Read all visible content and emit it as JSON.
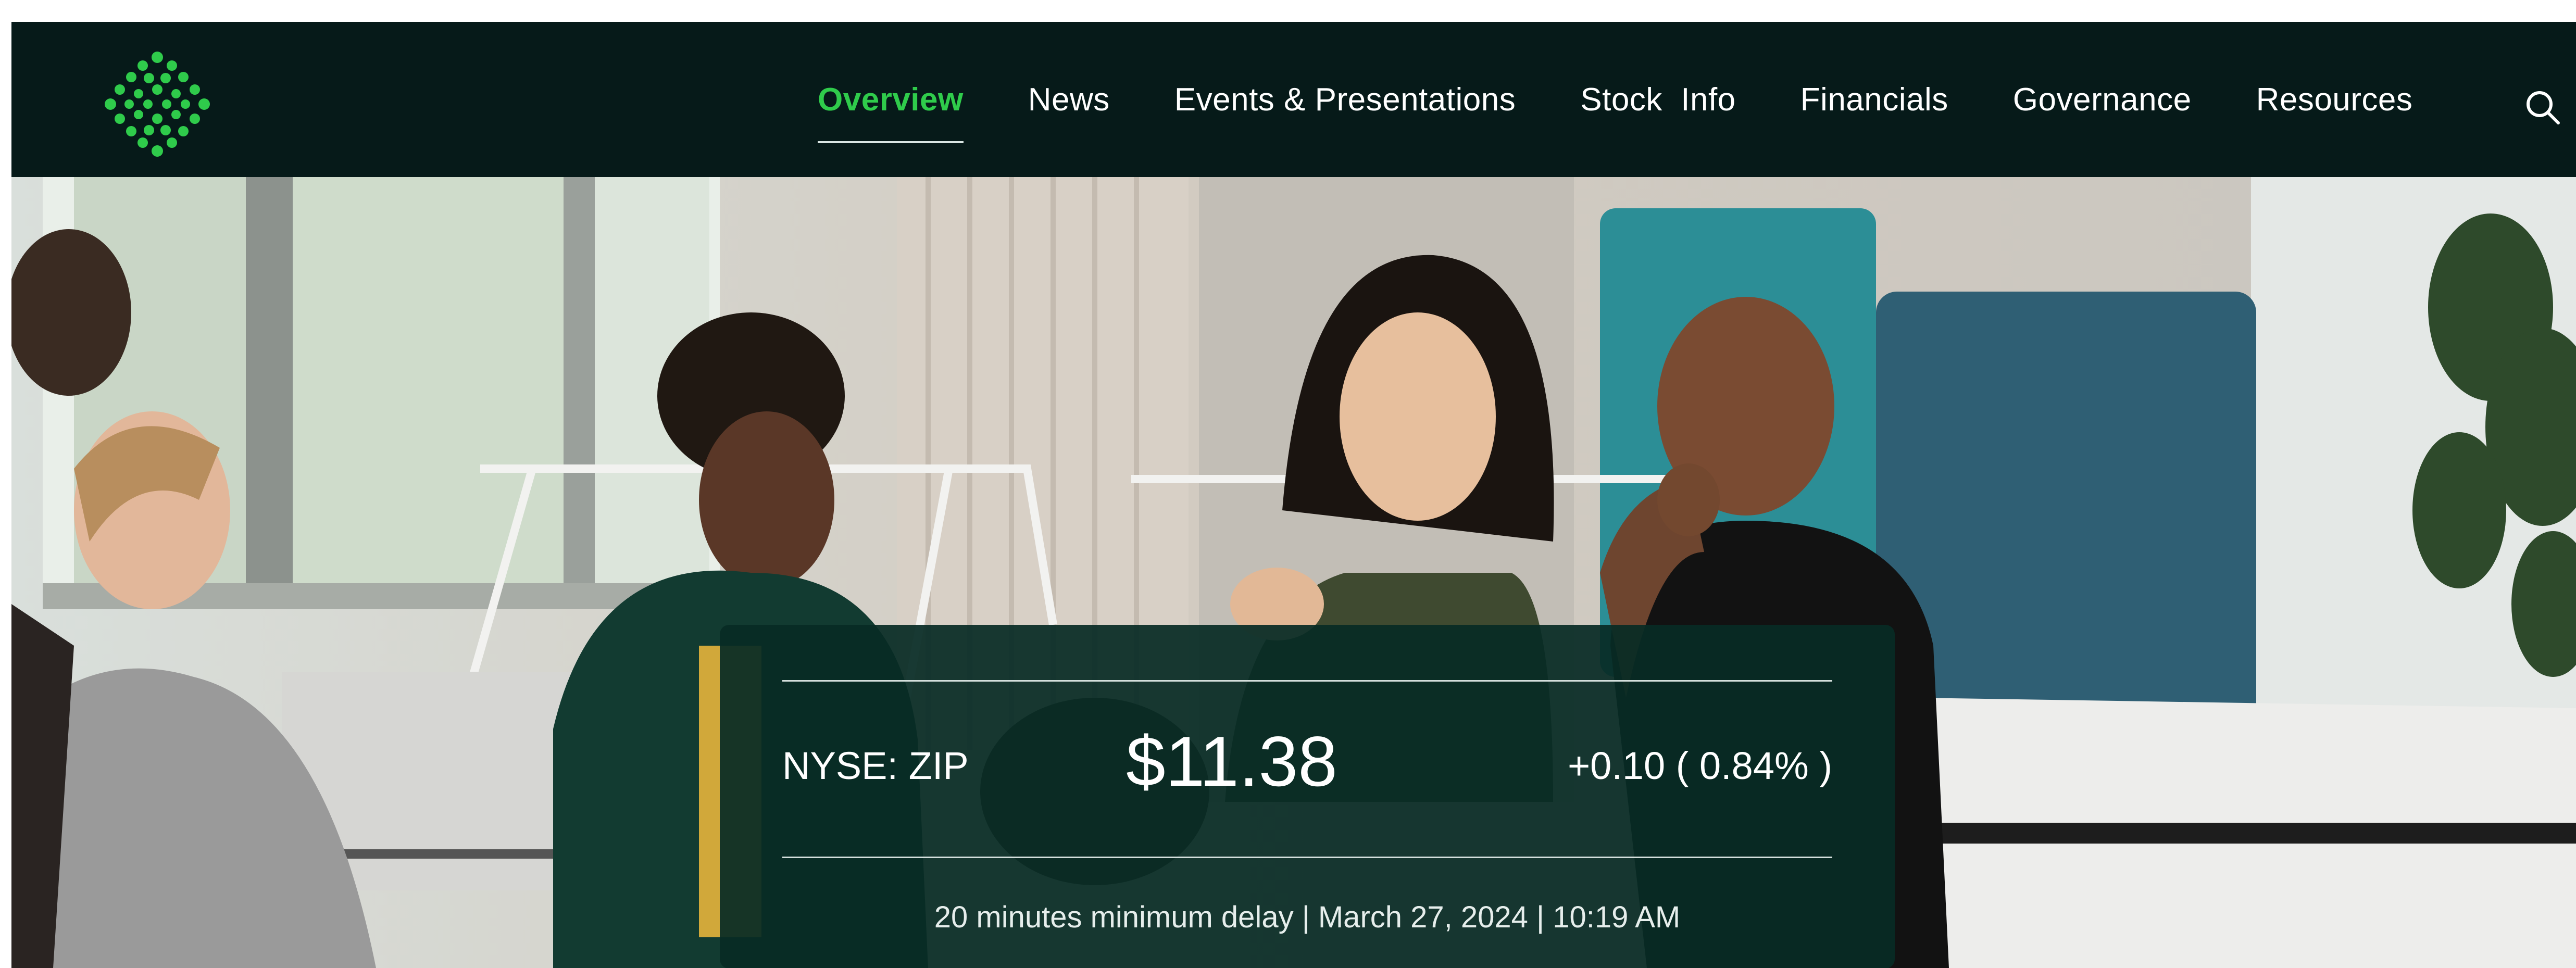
{
  "nav": {
    "items": [
      {
        "label": "Overview",
        "active": true
      },
      {
        "label": "News",
        "active": false
      },
      {
        "label": "Events & Presentations",
        "active": false
      },
      {
        "label": "Stock  Info",
        "active": false
      },
      {
        "label": "Financials",
        "active": false
      },
      {
        "label": "Governance",
        "active": false
      },
      {
        "label": "Resources",
        "active": false
      }
    ],
    "search_icon": "search-icon",
    "logo_icon": "dotted-x-logo"
  },
  "quote": {
    "ticker": "NYSE: ZIP",
    "price": "$11.38",
    "change": "+0.10 ( 0.84% )",
    "delay_note": "20 minutes minimum delay | March 27, 2024 | 10:19 AM"
  },
  "colors": {
    "nav_bg": "#061a19",
    "accent": "#2fcb4b",
    "card_bg": "#072b25",
    "text": "#ffffff"
  }
}
